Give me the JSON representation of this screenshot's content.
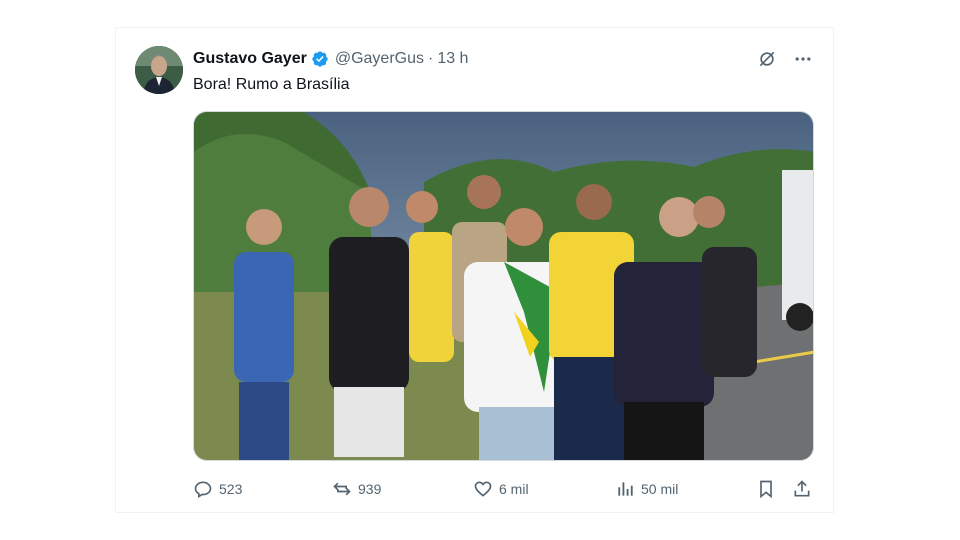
{
  "tweet": {
    "author_name": "Gustavo Gayer",
    "handle": "@GayerGus",
    "separator": "·",
    "time": "13 h",
    "text": "Bora! Rumo a Brasília",
    "verified": true
  },
  "top_actions": {
    "grok_icon": "grok-icon",
    "more_icon": "more-icon"
  },
  "metrics": {
    "replies": "523",
    "reposts": "939",
    "likes": "6 mil",
    "views": "50 mil"
  },
  "photo": {
    "description_icon": "photo"
  },
  "colors": {
    "text_primary": "#0f1419",
    "text_secondary": "#536471",
    "verified_blue": "#1d9bf0",
    "border": "#eff3f4"
  }
}
